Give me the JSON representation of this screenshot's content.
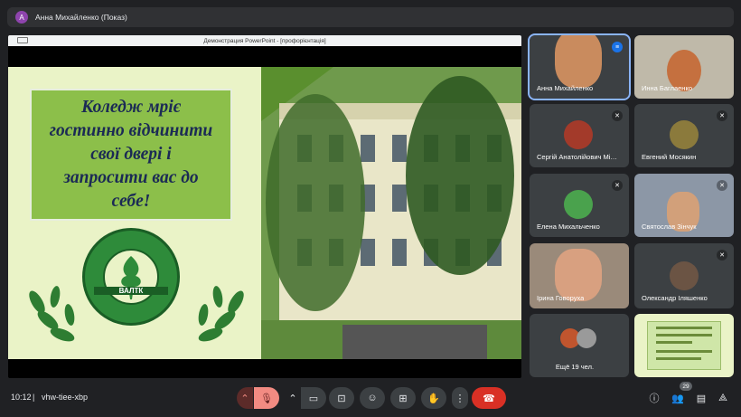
{
  "presenter_bar": {
    "avatar_letter": "А",
    "label": "Анна Михайленко (Показ)"
  },
  "presentation": {
    "window_title": "Демонстрация PowerPoint - [профорієнтація]",
    "slide_text": "Коледж мріє\nгостинно відчинити\nсвої двері і\nзапросити вас до\nсебе!",
    "logo_text": "ВАЛТК"
  },
  "participants": [
    {
      "name": "Анна Михайленко",
      "speaking": true
    },
    {
      "name": "Инна Баглаенко",
      "muted": false
    },
    {
      "name": "Сергій Анатолійович Мі…",
      "muted": true
    },
    {
      "name": "Евгений Мосякин",
      "muted": true
    },
    {
      "name": "Елена Михальченко",
      "muted": true
    },
    {
      "name": "Святослав Зінчук",
      "muted": true
    },
    {
      "name": "Ірина Говоруха",
      "muted": true
    },
    {
      "name": "Олександр Іляшенко",
      "muted": true
    },
    {
      "name": "Ещё 19 чел."
    }
  ],
  "bottom_bar": {
    "time": "10:12",
    "meeting_code": "vhw-tiee-xbp",
    "people_count": "29"
  },
  "colors": {
    "background": "#202124",
    "tile": "#3c4043",
    "end_call": "#d93025",
    "mic_off": "#f28b82",
    "active_outline": "#8ab4f8"
  }
}
